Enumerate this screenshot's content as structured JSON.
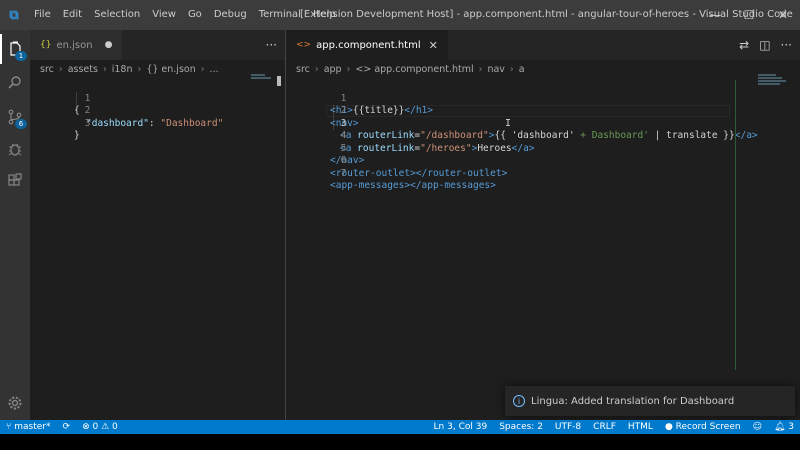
{
  "window": {
    "title": "[Extension Development Host] - app.component.html - angular-tour-of-heroes - Visual Studio Code",
    "minimize": "—",
    "maximize": "☐",
    "close": "✕"
  },
  "menu": [
    "File",
    "Edit",
    "Selection",
    "View",
    "Go",
    "Debug",
    "Terminal",
    "Help"
  ],
  "activity_bar": {
    "explorer_badge": "1",
    "scm_badge": "6"
  },
  "left_editor": {
    "tab": {
      "icon": "{}",
      "label": "en.json",
      "dirty": "●"
    },
    "actions": "···",
    "breadcrumb": [
      "src",
      "assets",
      "i18n",
      "{} en.json",
      "..."
    ],
    "lines": [
      {
        "num": "1"
      },
      {
        "num": "2",
        "key": "\"dashboard\"",
        "colon": ": ",
        "value": "\"Dashboard\""
      },
      {
        "num": "3"
      }
    ],
    "open_brace": "{",
    "close_brace": "}"
  },
  "right_editor": {
    "tab": {
      "icon": "<>",
      "label": "app.component.html",
      "close": "✕"
    },
    "breadcrumb": [
      "src",
      "app",
      "<> app.component.html",
      "nav",
      "a"
    ],
    "lines": [
      {
        "num": "1",
        "p1": "<h1>",
        "p2": "{{title}}",
        "p3": "</h1>"
      },
      {
        "num": "2",
        "p1": "<nav>"
      },
      {
        "num": "3",
        "p1": "<a ",
        "attr": "routerLink",
        "eq": "=",
        "str": "\"/dashboard\"",
        "p2": ">",
        "expr_open": "{{ ",
        "lit": "'dashboard'",
        "hint": " + Dashboard'",
        "pipe": " | translate ",
        "expr_close": "}}",
        "end": "</a>"
      },
      {
        "num": "4",
        "p1": "<a ",
        "attr": "routerLink",
        "eq": "=",
        "str": "\"/heroes\"",
        "p2": ">",
        "text": "Heroes",
        "end": "</a>"
      },
      {
        "num": "5",
        "p1": "</nav>"
      },
      {
        "num": "6",
        "p1": "<router-outlet>",
        "p2": "</router-outlet>"
      },
      {
        "num": "7",
        "p1": "<app-messages>",
        "p2": "</app-messages>"
      }
    ]
  },
  "notification": {
    "message": "Lingua: Added translation for Dashboard"
  },
  "status_bar": {
    "branch": "master*",
    "sync": "⟳",
    "errors": "0",
    "warnings": "0",
    "position": "Ln 3, Col 39",
    "spaces": "Spaces: 2",
    "encoding": "UTF-8",
    "eol": "CRLF",
    "language": "HTML",
    "record": "Record Screen",
    "bell_count": "3"
  },
  "colors": {
    "accent": "#007acc",
    "titlebar": "#3c3c3c",
    "editor_bg": "#1e1e1e"
  }
}
